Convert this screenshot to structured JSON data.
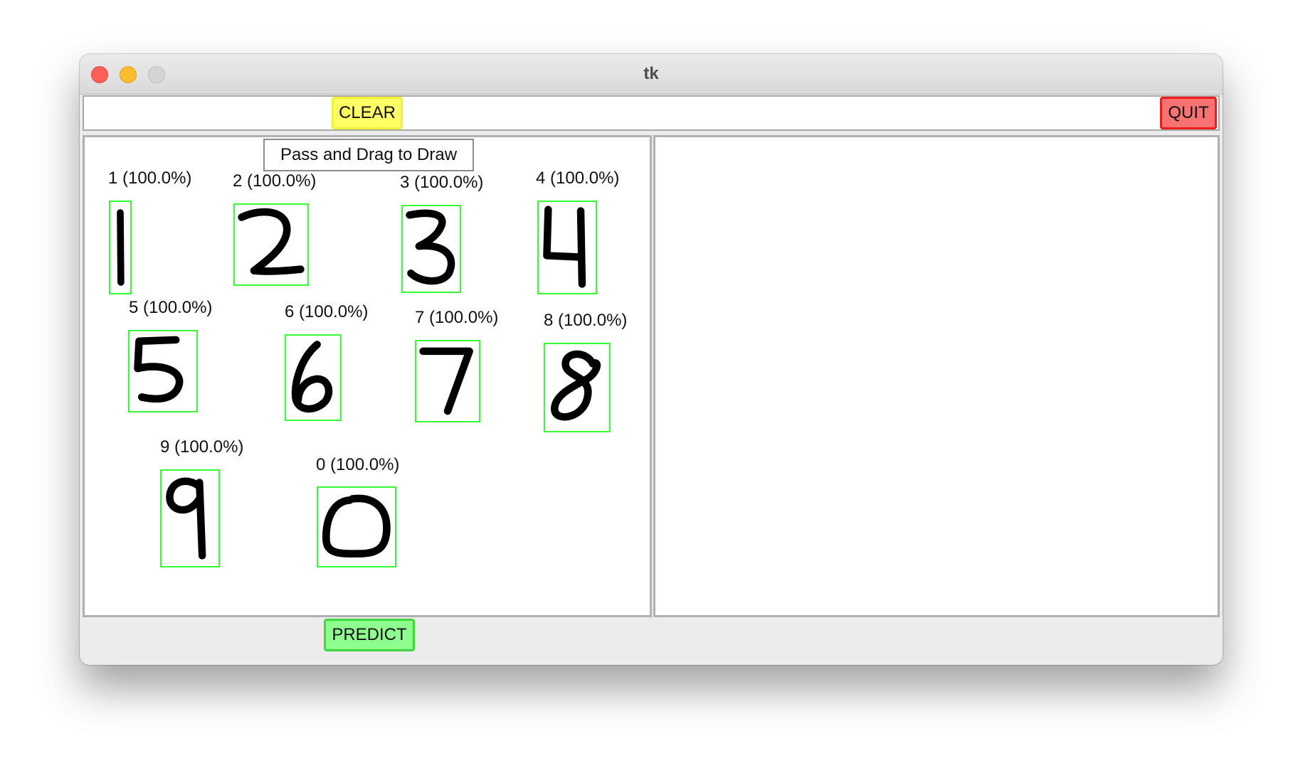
{
  "window": {
    "title": "tk"
  },
  "toolbar": {
    "clear_label": "CLEAR",
    "quit_label": "QUIT"
  },
  "canvas": {
    "hint": "Pass and Drag to Draw",
    "detections": [
      {
        "digit": "1",
        "label": "1 (100.0%)",
        "confidence": 100.0
      },
      {
        "digit": "2",
        "label": "2 (100.0%)",
        "confidence": 100.0
      },
      {
        "digit": "3",
        "label": "3 (100.0%)",
        "confidence": 100.0
      },
      {
        "digit": "4",
        "label": "4 (100.0%)",
        "confidence": 100.0
      },
      {
        "digit": "5",
        "label": "5 (100.0%)",
        "confidence": 100.0
      },
      {
        "digit": "6",
        "label": "6 (100.0%)",
        "confidence": 100.0
      },
      {
        "digit": "7",
        "label": "7 (100.0%)",
        "confidence": 100.0
      },
      {
        "digit": "8",
        "label": "8 (100.0%)",
        "confidence": 100.0
      },
      {
        "digit": "9",
        "label": "9 (100.0%)",
        "confidence": 100.0
      },
      {
        "digit": "0",
        "label": "0 (100.0%)",
        "confidence": 100.0
      }
    ]
  },
  "bottom": {
    "predict_label": "PREDICT"
  },
  "colors": {
    "clear_button": "#ffff66",
    "quit_button": "#f87272",
    "predict_button": "#8eff8e",
    "detection_box": "#33ff33",
    "stroke": "#000000"
  }
}
